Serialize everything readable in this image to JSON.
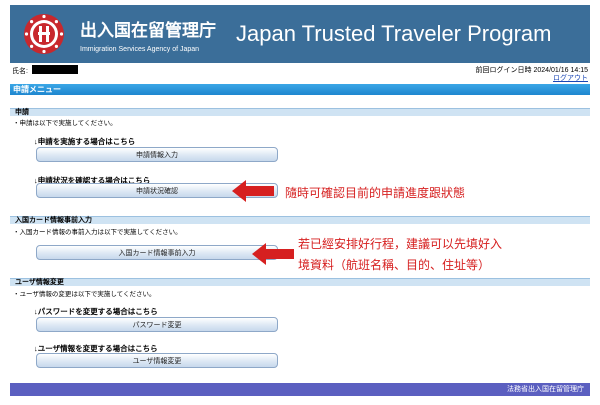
{
  "header": {
    "agency_name_jp": "出入国在留管理庁",
    "agency_name_en": "Immigration Services Agency of Japan",
    "program_title": "Japan Trusted Traveler Program",
    "emblem_icon": "agency-emblem-icon",
    "background_color": "#3b6e99"
  },
  "user_bar": {
    "name_label": "氏名:",
    "last_login": "前回ログイン日時 2024/01/16 14:15",
    "logout_label": "ログアウト"
  },
  "menu": {
    "title": "申請メニュー",
    "accent_color": "#1e86cf"
  },
  "sections": {
    "application": {
      "title": "申請",
      "description": "・申請は以下で実施してください。",
      "apply_heading": "↓申請を実施する場合はこちら",
      "apply_button": "申請情報入力",
      "status_heading": "↓申請状況を確認する場合はこちら",
      "status_button": "申請状況確認"
    },
    "arrival_card": {
      "title": "入国カード情報事前入力",
      "description": "・入国カード情報の事前入力は以下で実施してください。",
      "button": "入国カード情報事前入力"
    },
    "user_info": {
      "title": "ユーザ情報変更",
      "description": "・ユーザ情報の変更は以下で実施してください。",
      "password_heading": "↓パスワードを変更する場合はこちら",
      "password_button": "パスワード変更",
      "user_heading": "↓ユーザ情報を変更する場合はこちら",
      "user_button": "ユーザ情報変更"
    }
  },
  "annotations": {
    "status_note": "隨時可確認目前的申請進度跟狀態",
    "arrival_note_line1": "若已經安排好行程，建議可以先填好入",
    "arrival_note_line2": "境資料（航班名稱、目的、住址等）",
    "arrow_color": "#d62020"
  },
  "footer": {
    "text": "法務省出入国在留管理庁",
    "color": "#5b5fc0"
  }
}
